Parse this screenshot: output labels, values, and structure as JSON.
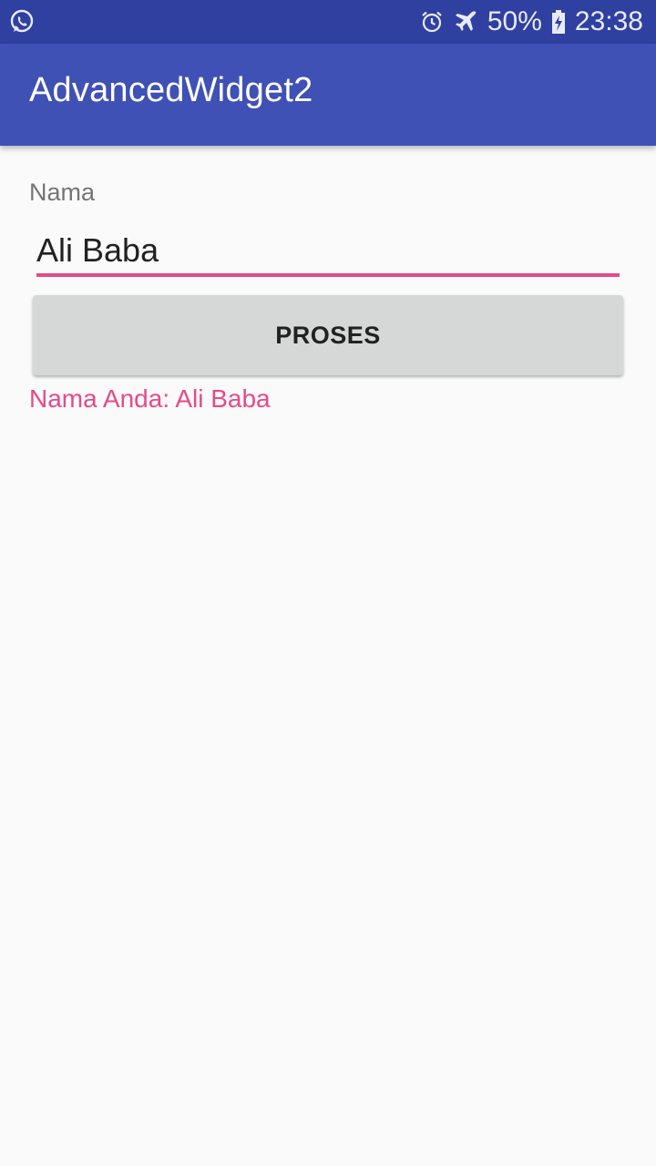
{
  "status_bar": {
    "battery_percent": "50%",
    "time": "23:38",
    "icons": [
      "whatsapp-icon",
      "alarm-icon",
      "airplane-icon",
      "battery-charging-icon"
    ]
  },
  "app_bar": {
    "title": "AdvancedWidget2"
  },
  "form": {
    "label": "Nama",
    "input_value": "Ali Baba",
    "button_label": "PROSES",
    "result": "Nama Anda: Ali Baba"
  },
  "colors": {
    "primary": "#3F51B5",
    "primary_dark": "#2F40A0",
    "accent": "#E64A8A",
    "button": "#D6D7D7",
    "background": "#FAFAFA"
  }
}
